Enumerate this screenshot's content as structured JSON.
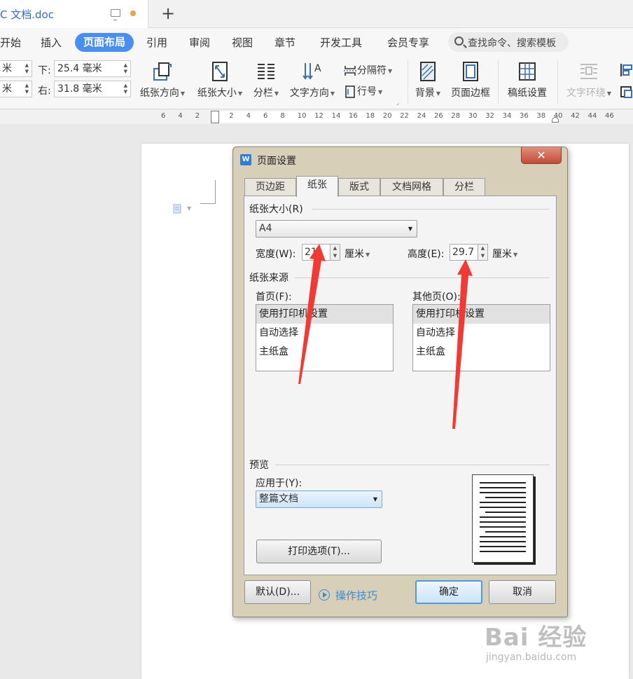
{
  "titlebar": {
    "doc_title": "C 文档.doc",
    "new_tab": "+"
  },
  "menu": {
    "items": [
      "开始",
      "插入",
      "页面布局",
      "引用",
      "审阅",
      "视图",
      "章节",
      "开发工具",
      "会员专享"
    ],
    "active": "页面布局",
    "search_placeholder": "查找命令、搜索模板"
  },
  "ribbon": {
    "margins": {
      "left_cut": "米",
      "left_cut2": "米",
      "bottom_label": "下:",
      "bottom_value": "25.4 毫米",
      "right_label": "右:",
      "right_value": "31.8 毫米"
    },
    "buttons": {
      "orientation": "纸张方向",
      "size": "纸张大小",
      "columns": "分栏",
      "text_direction": "文字方向",
      "separator": "分隔符",
      "line_number": "行号",
      "background": "背景",
      "page_border": "页面边框",
      "manuscript": "稿纸设置",
      "text_wrap": "文字环绕"
    }
  },
  "ruler": {
    "ticks": [
      "6",
      "4",
      "2",
      "2",
      "4",
      "6",
      "8",
      "10",
      "12",
      "14",
      "16",
      "18",
      "20",
      "22",
      "24",
      "26",
      "28",
      "30",
      "32",
      "34",
      "36",
      "38",
      "40",
      "42",
      "44",
      "46"
    ]
  },
  "dialog": {
    "title": "页面设置",
    "tabs": [
      "页边距",
      "纸张",
      "版式",
      "文档网格",
      "分栏"
    ],
    "active_tab": "纸张",
    "paper_size": {
      "group": "纸张大小(R)",
      "selected": "A4",
      "width_label": "宽度(W):",
      "width_value": "21",
      "width_unit": "厘米",
      "height_label": "高度(E):",
      "height_value": "29.7",
      "height_unit": "厘米"
    },
    "paper_source": {
      "group": "纸张来源",
      "first_page_label": "首页(F):",
      "other_pages_label": "其他页(O):",
      "options": [
        "使用打印机设置",
        "自动选择",
        "主纸盒"
      ],
      "selected_first": "使用打印机设置",
      "selected_other": "使用打印机设置"
    },
    "preview": {
      "group": "预览",
      "apply_label": "应用于(Y):",
      "apply_value": "整篇文档",
      "print_options": "打印选项(T)..."
    },
    "footer": {
      "default_button": "默认(D)...",
      "tips_link": "操作技巧",
      "ok_button": "确定",
      "cancel_button": "取消"
    }
  },
  "watermark": {
    "logo": "Bai 经验",
    "url": "jingyan.baidu.com"
  },
  "colors": {
    "accent": "#4a8ff0",
    "arrow": "#f23a35",
    "link": "#3c8ad8"
  }
}
